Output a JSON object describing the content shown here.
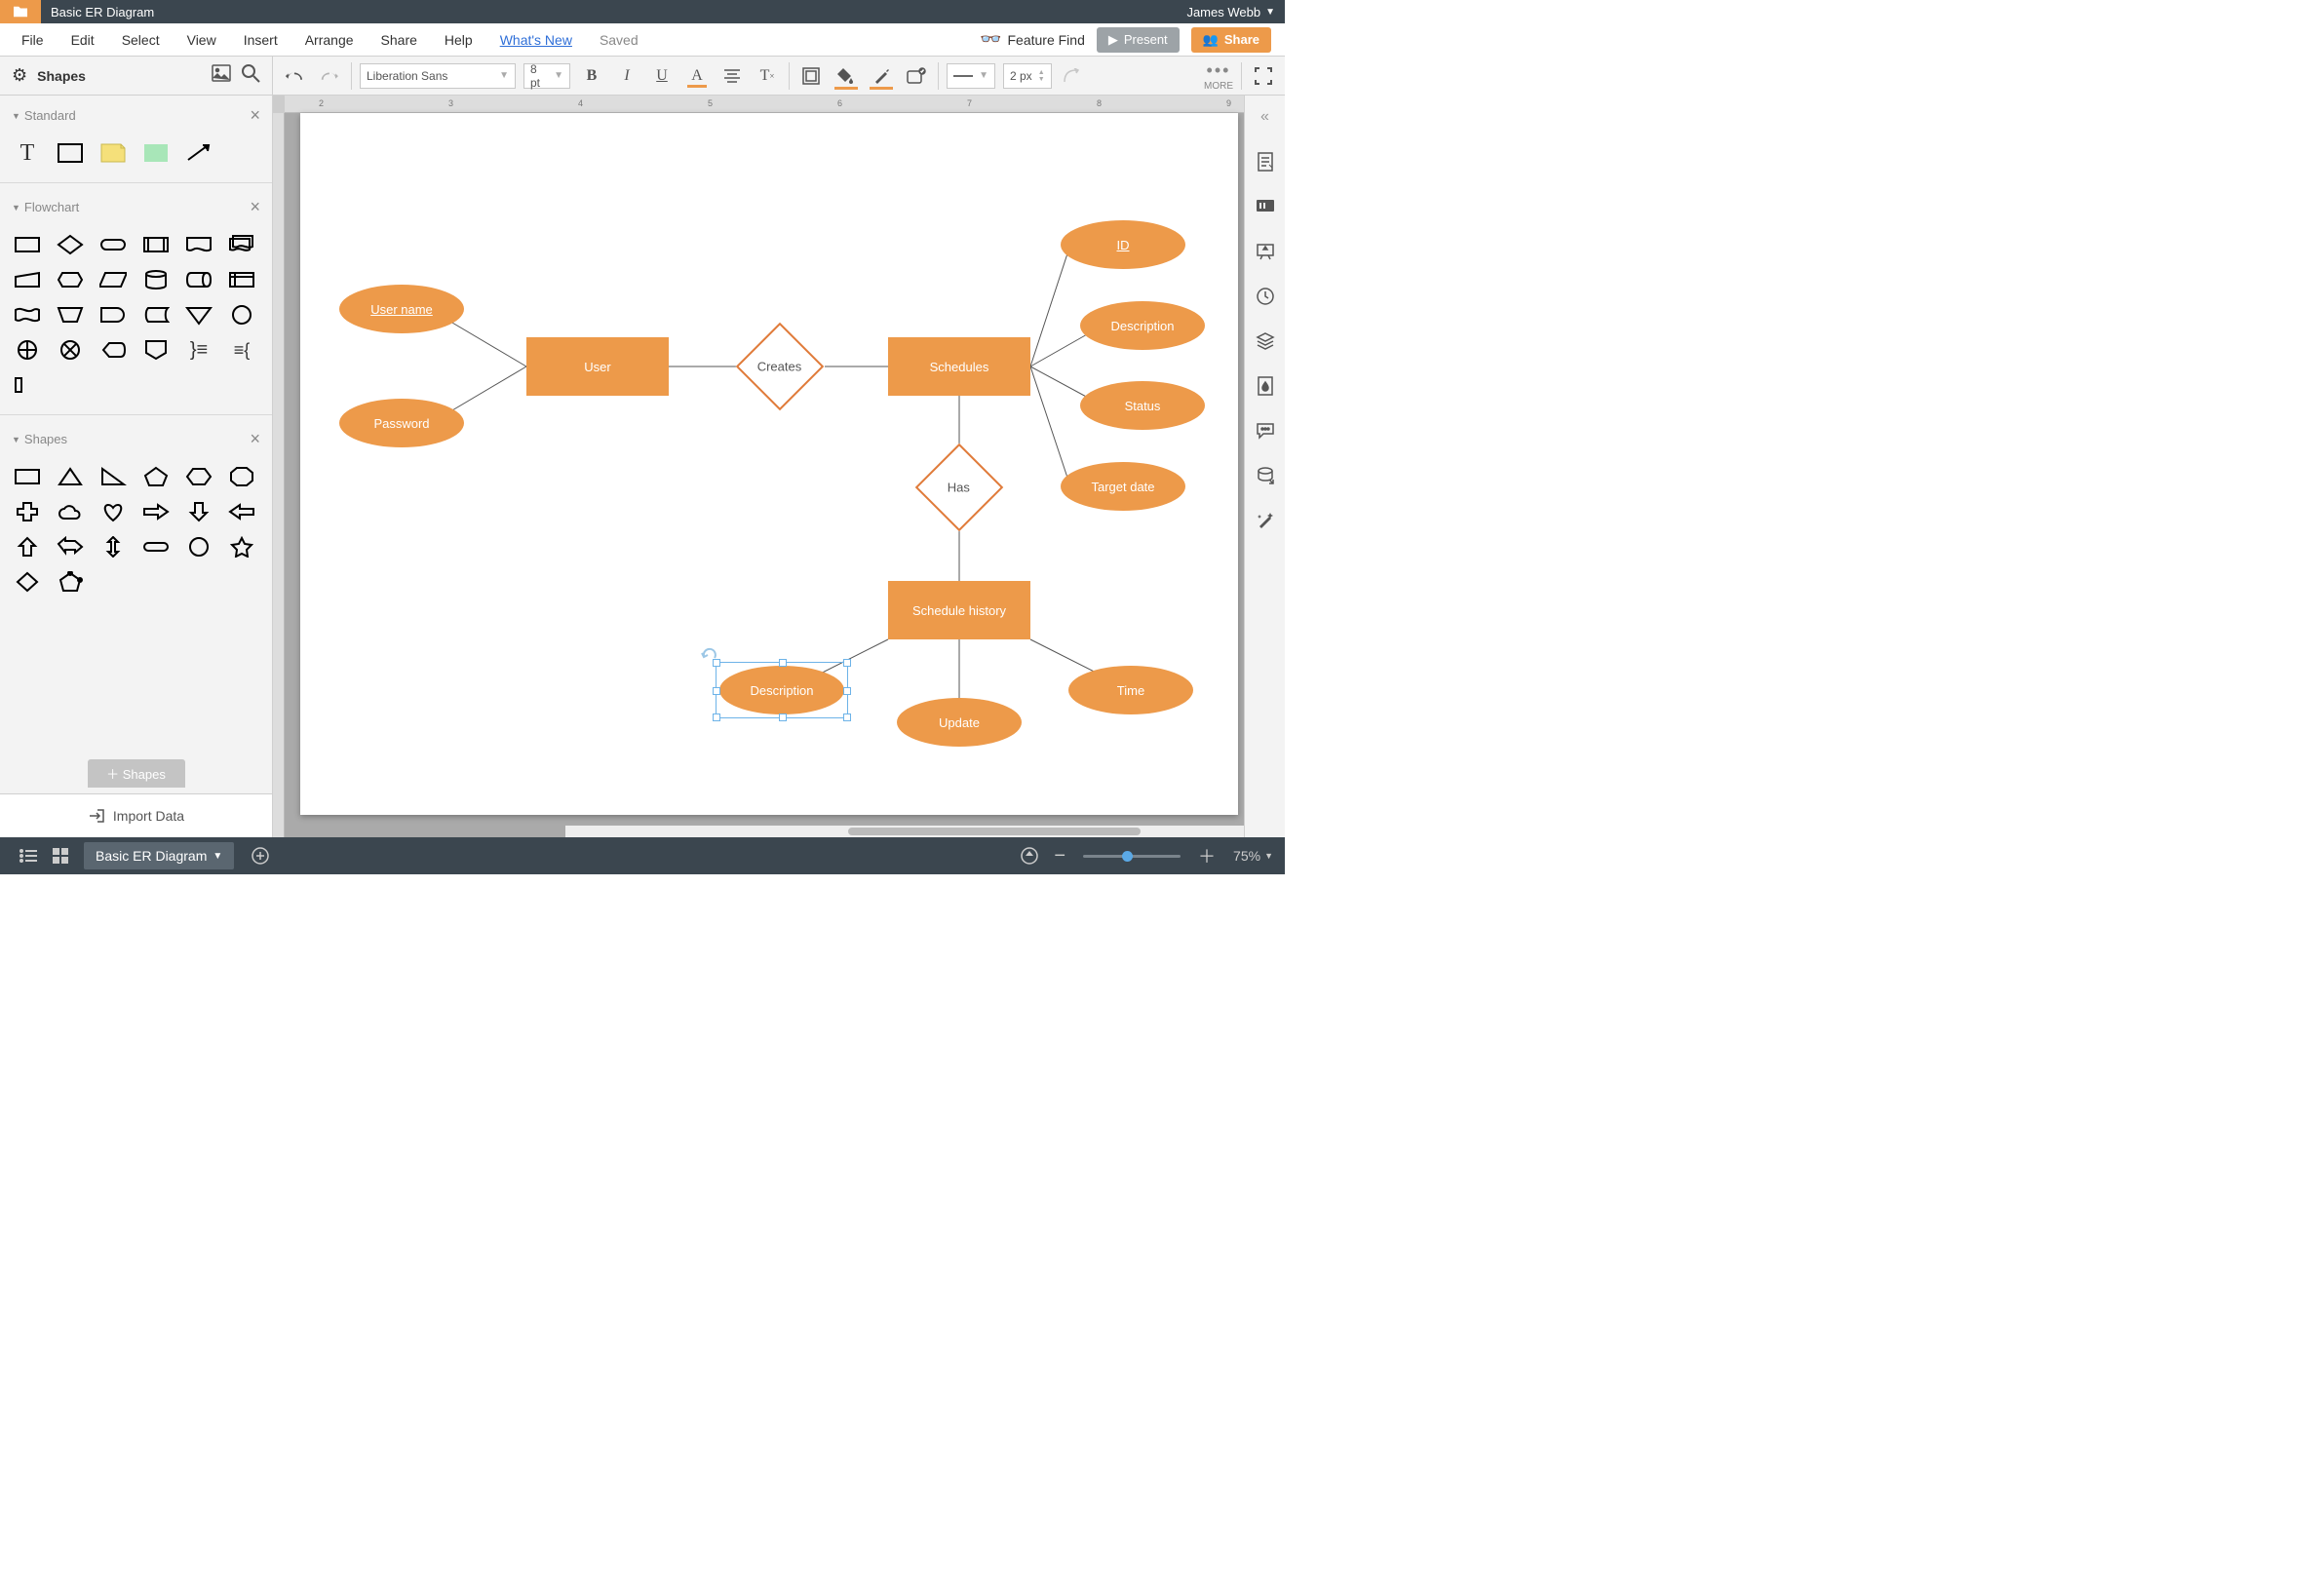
{
  "header": {
    "doc_title": "Basic ER Diagram",
    "user_name": "James Webb"
  },
  "menu": {
    "file": "File",
    "edit": "Edit",
    "select": "Select",
    "view": "View",
    "insert": "Insert",
    "arrange": "Arrange",
    "share": "Share",
    "help": "Help",
    "whats_new": "What's New",
    "saved": "Saved",
    "feature_find": "Feature Find",
    "present": "Present",
    "share_btn": "Share"
  },
  "left_panel": {
    "shapes_label": "Shapes",
    "standard": "Standard",
    "flowchart": "Flowchart",
    "shapes_section": "Shapes",
    "plus_shapes": "＋ Shapes",
    "import_data": "Import Data"
  },
  "toolbar": {
    "font_name": "Liberation Sans",
    "font_size": "8 pt",
    "line_width": "2 px",
    "more_label": "MORE"
  },
  "diagram": {
    "user_name_attr": "User name",
    "password_attr": "Password",
    "user_entity": "User",
    "creates_rel": "Creates",
    "schedules_entity": "Schedules",
    "has_rel": "Has",
    "id_attr": "ID",
    "description_attr": "Description",
    "status_attr": "Status",
    "target_date_attr": "Target date",
    "schedule_history_entity": "Schedule history",
    "description2_attr": "Description",
    "update_attr": "Update",
    "time_attr": "Time"
  },
  "status": {
    "tab_name": "Basic ER Diagram",
    "zoom_level": "75%"
  },
  "right_rail": {
    "collapse": "collapse-panel",
    "icons": [
      "page-icon",
      "comment-icon",
      "present-icon",
      "history-icon",
      "layers-icon",
      "fill-icon",
      "chat-icon",
      "data-icon",
      "magic-icon"
    ]
  }
}
